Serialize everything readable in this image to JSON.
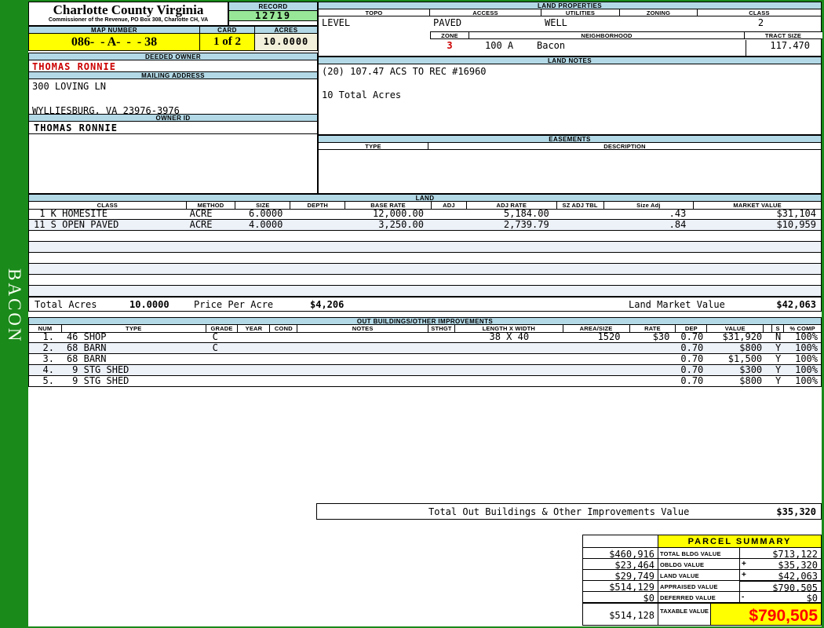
{
  "colors": {
    "frame_green": "#1a8a1a",
    "header_blue": "#b3d9e6",
    "highlight_yellow": "#ffff00",
    "record_green": "#98e798",
    "acres_beige": "#f2f0da",
    "row_stripe": "#edf1f8",
    "owner_red": "#cc0000",
    "taxable_red": "#ff0000"
  },
  "sidebar": {
    "label": "BACON"
  },
  "header": {
    "county_title": "Charlotte County Virginia",
    "county_subtitle": "Commissioner of the Revenue, PO Box 308, Charlotte CH, VA",
    "record_label": "RECORD",
    "record_value": "12719",
    "map_number_label": "MAP NUMBER",
    "map_number_value": "086-  - A-  -  - 38",
    "card_label": "CARD",
    "card_value": "1 of 2",
    "acres_label": "ACRES",
    "acres_value": "10.0000"
  },
  "owner": {
    "deeded_owner_label": "DEEDED OWNER",
    "deeded_owner": "THOMAS RONNIE",
    "mailing_address_label": "MAILING ADDRESS",
    "address_line1": "300 LOVING LN",
    "address_line2": "WYLLIESBURG, VA 23976-3976",
    "owner_id_label": "OWNER ID",
    "owner_id": "THOMAS RONNIE"
  },
  "land_properties": {
    "title": "LAND PROPERTIES",
    "headers": {
      "topo": "TOPO",
      "access": "ACCESS",
      "utilities": "UTILITIES",
      "zoning": "ZONING",
      "class": "CLASS"
    },
    "values": {
      "topo": "LEVEL",
      "access": "PAVED",
      "utilities": "WELL",
      "zoning": "",
      "class": "2"
    },
    "zone_label": "ZONE",
    "zone_value": "3",
    "neighborhood_label": "NEIGHBORHOOD",
    "neighborhood_code": "100 A",
    "neighborhood_name": "Bacon",
    "tract_size_label": "TRACT SIZE",
    "tract_size_value": "117.470"
  },
  "land_notes": {
    "title": "LAND NOTES",
    "line1": "(20) 107.47 ACS TO REC #16960",
    "line2": "10 Total Acres"
  },
  "easements": {
    "title": "EASEMENTS",
    "type_label": "TYPE",
    "description_label": "DESCRIPTION"
  },
  "land": {
    "title": "LAND",
    "headers": {
      "class": "CLASS",
      "method": "METHOD",
      "size": "SIZE",
      "depth": "DEPTH",
      "base_rate": "BASE RATE",
      "adj": "ADJ",
      "adj_rate": "ADJ RATE",
      "sz_adj_tbl": "SZ ADJ TBL",
      "size_adj": "Size Adj",
      "market_value": "MARKET VALUE"
    },
    "rows": [
      {
        "class": " 1 K HOMESITE",
        "method": "ACRE",
        "size": "6.0000",
        "depth": "",
        "base_rate": "12,000.00",
        "adj": "",
        "adj_rate": "5,184.00",
        "sz_adj_tbl": "",
        "size_adj": ".43",
        "market_value": "$31,104"
      },
      {
        "class": "11 S OPEN PAVED",
        "method": "ACRE",
        "size": "4.0000",
        "depth": "",
        "base_rate": "3,250.00",
        "adj": "",
        "adj_rate": "2,739.79",
        "sz_adj_tbl": "",
        "size_adj": ".84",
        "market_value": "$10,959"
      }
    ],
    "totals": {
      "total_acres_label": "Total Acres",
      "total_acres": "10.0000",
      "price_per_acre_label": "Price Per Acre",
      "price_per_acre": "$4,206",
      "land_market_value_label": "Land Market Value",
      "land_market_value": "$42,063"
    }
  },
  "out_buildings": {
    "title": "OUT BUILDINGS/OTHER IMPROVEMENTS",
    "headers": {
      "num": "NUM",
      "type": "TYPE",
      "grade": "GRADE",
      "year": "YEAR",
      "cond": "COND",
      "notes": "NOTES",
      "sthgt": "STHGT",
      "length_width": "LENGTH X WIDTH",
      "area_size": "AREA/SIZE",
      "rate": "RATE",
      "dep": "DEP",
      "value": "VALUE",
      "s": "S",
      "pct_comp": "% COMP"
    },
    "rows": [
      {
        "num": "1.",
        "type": "46 SHOP",
        "grade": "C",
        "year": "",
        "cond": "",
        "notes": "",
        "sthgt": "",
        "length_width": "38 X 40",
        "area_size": "1520",
        "rate": "$30",
        "dep": "0.70",
        "value": "$31,920",
        "s": "N",
        "pct_comp": "100%"
      },
      {
        "num": "2.",
        "type": "68 BARN",
        "grade": "C",
        "year": "",
        "cond": "",
        "notes": "",
        "sthgt": "",
        "length_width": "",
        "area_size": "",
        "rate": "",
        "dep": "0.70",
        "value": "$800",
        "s": "Y",
        "pct_comp": "100%"
      },
      {
        "num": "3.",
        "type": "68 BARN",
        "grade": "",
        "year": "",
        "cond": "",
        "notes": "",
        "sthgt": "",
        "length_width": "",
        "area_size": "",
        "rate": "",
        "dep": "0.70",
        "value": "$1,500",
        "s": "Y",
        "pct_comp": "100%"
      },
      {
        "num": "4.",
        "type": " 9 STG SHED",
        "grade": "",
        "year": "",
        "cond": "",
        "notes": "",
        "sthgt": "",
        "length_width": "",
        "area_size": "",
        "rate": "",
        "dep": "0.70",
        "value": "$300",
        "s": "Y",
        "pct_comp": "100%"
      },
      {
        "num": "5.",
        "type": " 9 STG SHED",
        "grade": "",
        "year": "",
        "cond": "",
        "notes": "",
        "sthgt": "",
        "length_width": "",
        "area_size": "",
        "rate": "",
        "dep": "0.70",
        "value": "$800",
        "s": "Y",
        "pct_comp": "100%"
      }
    ],
    "total_label": "Total Out Buildings & Other Improvements Value",
    "total_value": "$35,320"
  },
  "parcel_summary": {
    "title": "PARCEL SUMMARY",
    "rows": [
      {
        "left": "$460,916",
        "label": "TOTAL BLDG VALUE",
        "op": "",
        "right": "$713,122"
      },
      {
        "left": "$23,464",
        "label": "OBLDG VALUE",
        "op": "+",
        "right": "$35,320"
      },
      {
        "left": "$29,749",
        "label": "LAND VALUE",
        "op": "+",
        "right": "$42,063"
      },
      {
        "left": "$514,129",
        "label": "APPRAISED VALUE",
        "op": "",
        "right": "$790,505"
      },
      {
        "left": "$0",
        "label": "DEFERRED VALUE",
        "op": "-",
        "right": "$0"
      }
    ],
    "taxable": {
      "left": "$514,128",
      "label": "TAXABLE VALUE",
      "value": "$790,505"
    }
  }
}
